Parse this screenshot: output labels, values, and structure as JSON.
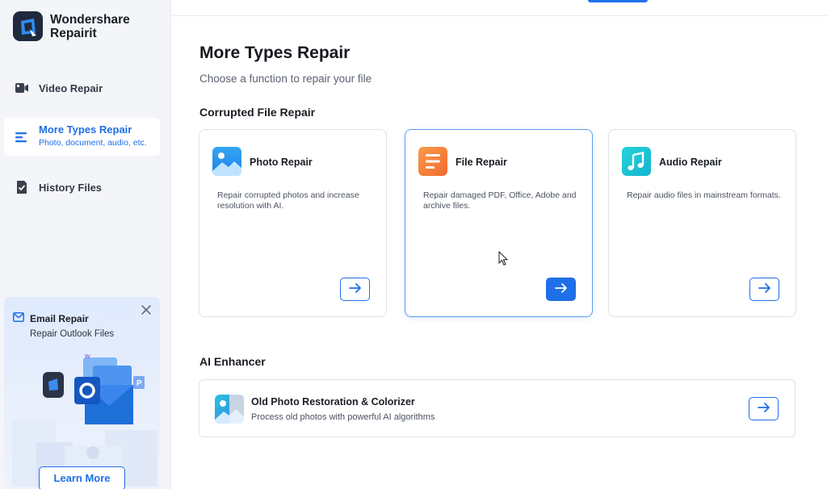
{
  "brand": {
    "line1": "Wondershare",
    "line2": "Repairit"
  },
  "nav": [
    {
      "label": "Video Repair",
      "icon": "video-camera-icon"
    },
    {
      "label": "More Types Repair",
      "sub": "Photo, document, audio, etc.",
      "icon": "list-icon",
      "active": true
    },
    {
      "label": "History Files",
      "icon": "history-file-icon"
    }
  ],
  "promo": {
    "title": "Email Repair",
    "subtitle": "Repair Outlook Files",
    "button": "Learn More"
  },
  "main": {
    "title": "More Types Repair",
    "subtitle": "Choose a function to repair your file",
    "sections": {
      "corrupted": "Corrupted File Repair",
      "ai": "AI Enhancer"
    },
    "cards": [
      {
        "title": "Photo Repair",
        "desc": "Repair corrupted photos and increase resolution with AI.",
        "icon": "photo-icon"
      },
      {
        "title": "File Repair",
        "desc": "Repair damaged PDF, Office, Adobe and archive files.",
        "icon": "document-icon",
        "active": true
      },
      {
        "title": "Audio Repair",
        "desc": "Repair audio files in mainstream formats.",
        "icon": "music-note-icon"
      }
    ],
    "ai_card": {
      "title": "Old Photo Restoration & Colorizer",
      "desc": "Process old photos with powerful AI algorithms",
      "icon": "old-photo-icon"
    }
  },
  "colors": {
    "accent": "#1e6fe8",
    "sidebar_bg": "#f3f5f9",
    "photo_icon": "#2e9bf0",
    "file_icon": "#f4873a",
    "audio_icon": "#1ec7d6"
  }
}
